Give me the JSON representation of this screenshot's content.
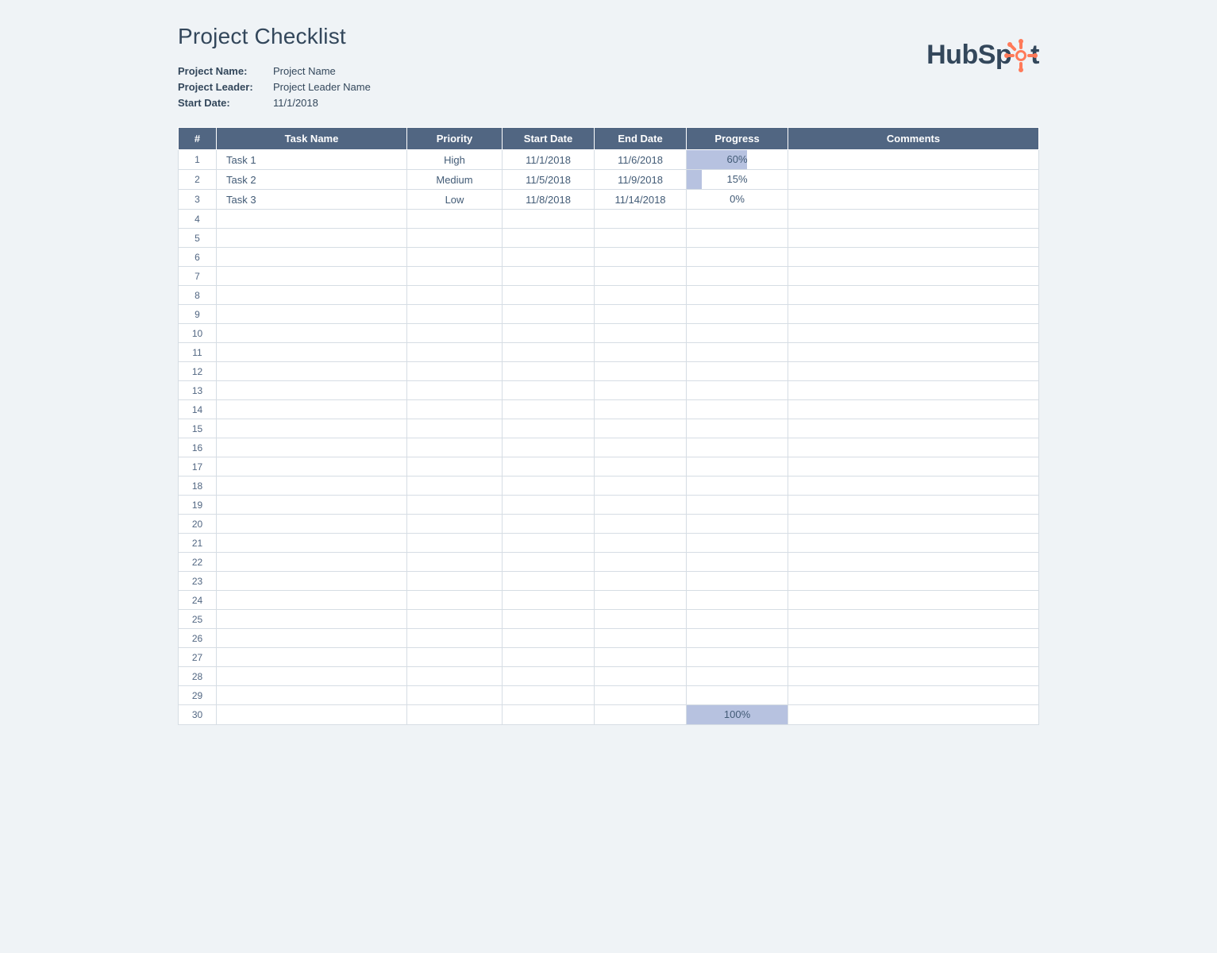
{
  "title": "Project Checklist",
  "meta": {
    "project_name_label": "Project Name:",
    "project_name_value": "Project Name",
    "project_leader_label": "Project Leader:",
    "project_leader_value": "Project Leader Name",
    "start_date_label": "Start Date:",
    "start_date_value": "11/1/2018"
  },
  "logo": {
    "text_left": "HubSp",
    "text_right": "t",
    "brand": "HubSpot",
    "accent_color": "#ff7a59"
  },
  "columns": {
    "num": "#",
    "task": "Task Name",
    "priority": "Priority",
    "start": "Start Date",
    "end": "End Date",
    "progress": "Progress",
    "comments": "Comments"
  },
  "row_count": 30,
  "rows": [
    {
      "num": "1",
      "task": "Task 1",
      "priority": "High",
      "priority_class": "pri-high",
      "start": "11/1/2018",
      "end": "11/6/2018",
      "progress_pct": 60,
      "progress_label": "60%",
      "comments": ""
    },
    {
      "num": "2",
      "task": "Task 2",
      "priority": "Medium",
      "priority_class": "pri-medium",
      "start": "11/5/2018",
      "end": "11/9/2018",
      "progress_pct": 15,
      "progress_label": "15%",
      "comments": ""
    },
    {
      "num": "3",
      "task": "Task 3",
      "priority": "Low",
      "priority_class": "pri-low",
      "start": "11/8/2018",
      "end": "11/14/2018",
      "progress_pct": 0,
      "progress_label": "0%",
      "comments": ""
    },
    {
      "num": "4"
    },
    {
      "num": "5"
    },
    {
      "num": "6"
    },
    {
      "num": "7"
    },
    {
      "num": "8"
    },
    {
      "num": "9"
    },
    {
      "num": "10"
    },
    {
      "num": "11"
    },
    {
      "num": "12"
    },
    {
      "num": "13"
    },
    {
      "num": "14"
    },
    {
      "num": "15"
    },
    {
      "num": "16"
    },
    {
      "num": "17"
    },
    {
      "num": "18"
    },
    {
      "num": "19"
    },
    {
      "num": "20"
    },
    {
      "num": "21"
    },
    {
      "num": "22"
    },
    {
      "num": "23"
    },
    {
      "num": "24"
    },
    {
      "num": "25"
    },
    {
      "num": "26"
    },
    {
      "num": "27"
    },
    {
      "num": "28"
    },
    {
      "num": "29"
    },
    {
      "num": "30",
      "progress_pct": 100,
      "progress_label": "100%"
    }
  ]
}
